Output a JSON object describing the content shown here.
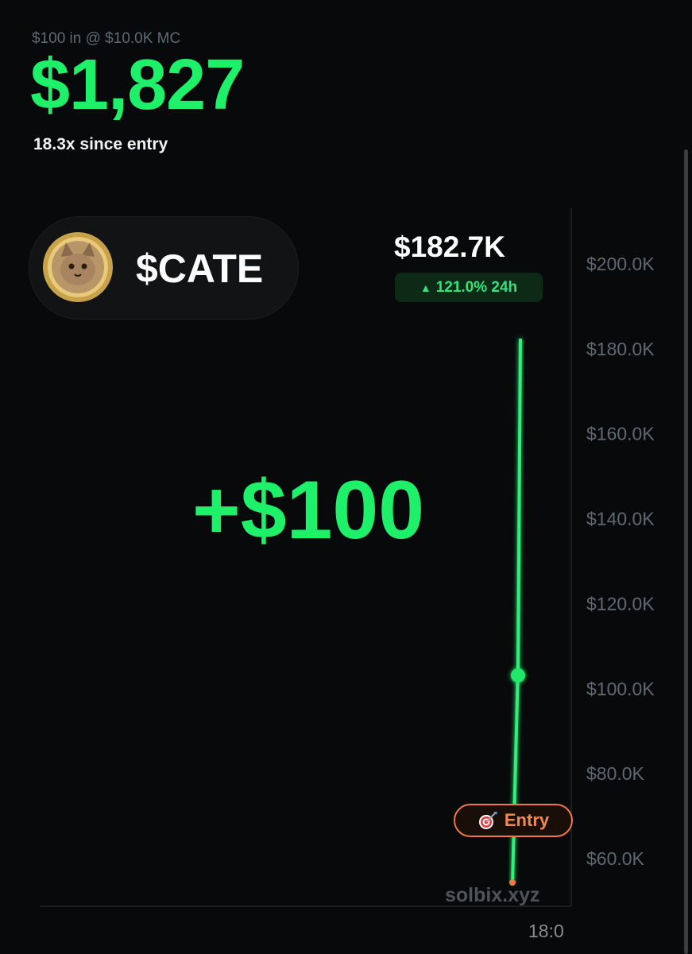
{
  "header": {
    "caption": "$100 in @ $10.0K MC",
    "value": "$1,827",
    "multiplier": "18.3x since entry"
  },
  "token": {
    "symbol": "$CATE",
    "avatar_icon": "cat-coin-avatar"
  },
  "price": {
    "current": "$182.7K",
    "change_arrow": "▲",
    "change": "121.0% 24h"
  },
  "overlay": {
    "gain": "+$100",
    "entry_label": "Entry",
    "entry_icon": "target-icon",
    "watermark": "solbix.xyz"
  },
  "colors": {
    "accent": "#1ff06a",
    "entry": "#f07a45",
    "background": "#08090a"
  },
  "chart_data": {
    "type": "line",
    "title": "",
    "xlabel": "",
    "ylabel": "",
    "x_ticks": [
      "18:0"
    ],
    "y_ticks": [
      "$200.0K",
      "$180.0K",
      "$160.0K",
      "$140.0K",
      "$120.0K",
      "$100.0K",
      "$80.0K",
      "$60.0K"
    ],
    "y_tick_values": [
      200000,
      180000,
      160000,
      140000,
      120000,
      100000,
      80000,
      60000
    ],
    "ylim": [
      52000,
      210000
    ],
    "series": [
      {
        "points": [
          {
            "y": 54000
          },
          {
            "y": 105000
          },
          {
            "y": 182700
          }
        ]
      }
    ],
    "markers": [
      {
        "label": "Entry",
        "y": 54000
      },
      {
        "y": 105000
      }
    ],
    "grid": false,
    "legend": "none"
  }
}
